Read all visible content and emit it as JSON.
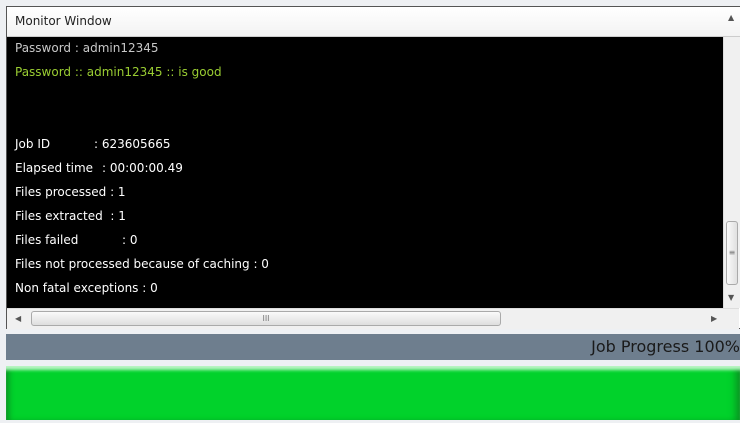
{
  "monitor": {
    "title": "Monitor Window",
    "lines": {
      "password": "Password : admin12345",
      "password_check": "Password :: admin12345 :: is good",
      "job_id_label": "Job ID",
      "job_id_value": ": 623605665",
      "elapsed_label": "Elapsed time",
      "elapsed_value": ": 00:00:00.49",
      "files_processed": "Files processed : 1",
      "files_extracted": "Files extracted  : 1",
      "files_failed_label": "Files failed",
      "files_failed_value": ": 0",
      "not_processed": "Files not processed because of caching : 0",
      "non_fatal": "Non fatal exceptions : 0"
    }
  },
  "progress": {
    "label": "Job Progress 100%",
    "value_percent": 100,
    "color": "#01d22b"
  }
}
